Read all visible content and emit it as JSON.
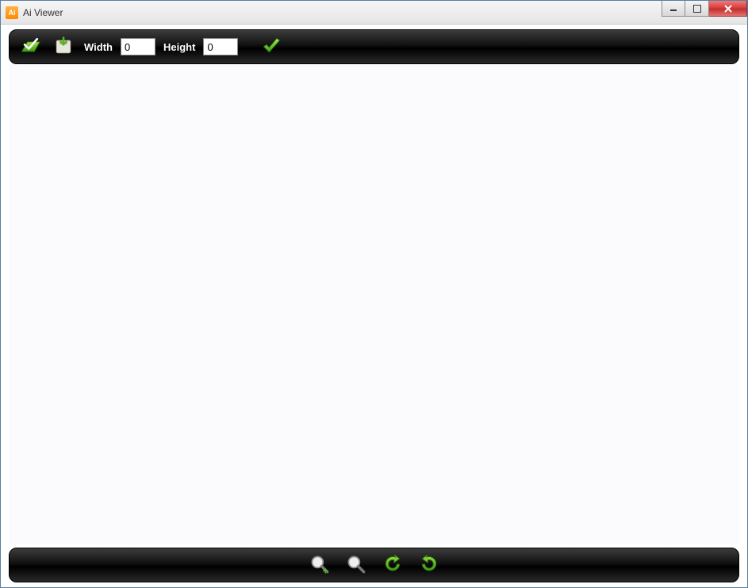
{
  "window": {
    "title": "Ai Viewer",
    "app_icon_text": "Ai"
  },
  "toolbar": {
    "width_label": "Width",
    "width_value": "0",
    "height_label": "Height",
    "height_value": "0"
  }
}
